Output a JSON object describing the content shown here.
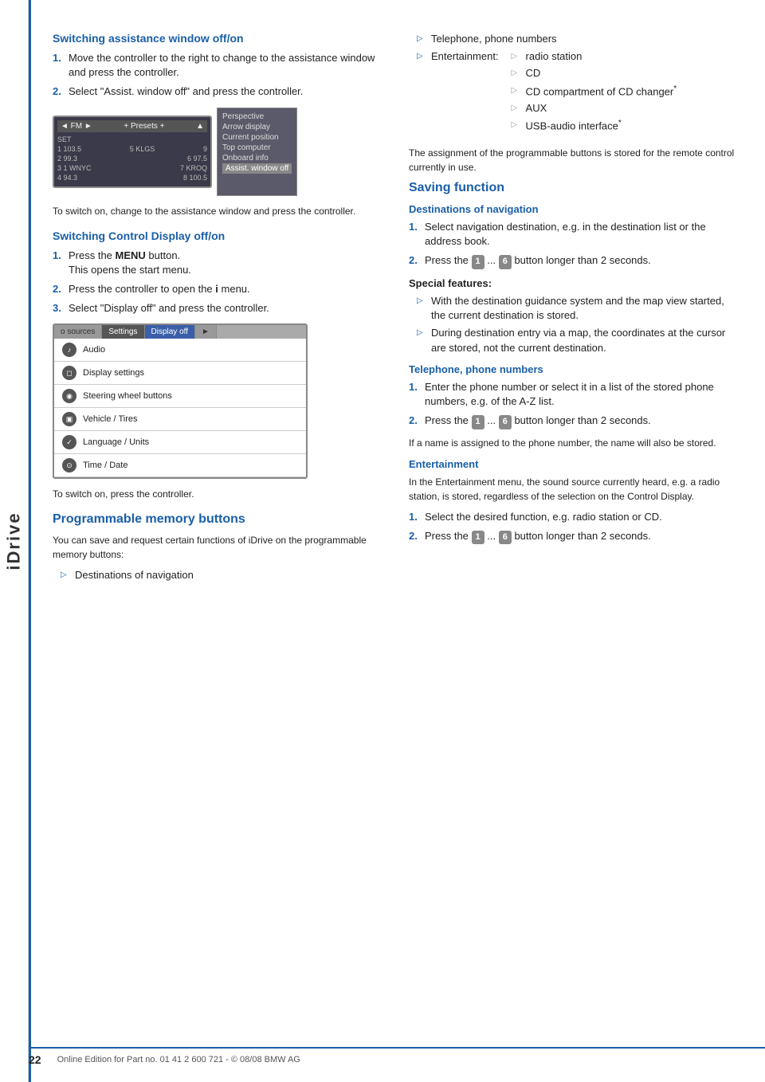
{
  "sidebar": {
    "label": "iDrive"
  },
  "page": {
    "number": "22",
    "footer_text": "Online Edition for Part no. 01 41 2 600 721 - © 08/08 BMW AG"
  },
  "left_col": {
    "section1": {
      "heading": "Switching assistance window off/on",
      "steps": [
        {
          "num": "1.",
          "text": "Move the controller to the right to change to the assistance window and press the controller."
        },
        {
          "num": "2.",
          "text": "Select \"Assist. window off\" and press the controller."
        }
      ],
      "note": "To switch on, change to the assistance window and press the controller.",
      "screen": {
        "header_left": "◄ FM ►",
        "header_right": "▲",
        "presets": "+ Presets +",
        "set_label": "SET",
        "rows": [
          {
            "freq1": "1 103.5",
            "freq2": "5 KLGS",
            "freq3": "9"
          },
          {
            "freq1": "2 99.3",
            "freq2": "6 97.5"
          },
          {
            "freq1": "3 1 WNYC",
            "freq2": "7 KROQ"
          },
          {
            "freq1": "4 94.3",
            "freq2": "8 100.5"
          }
        ],
        "menu_items": [
          {
            "label": "Perspective",
            "active": false
          },
          {
            "label": "Arrow display",
            "active": false
          },
          {
            "label": "Current position",
            "active": false
          },
          {
            "label": "Top computer",
            "active": false
          },
          {
            "label": "Onboard info",
            "active": false
          },
          {
            "label": "Assist. window off",
            "active": true
          }
        ]
      }
    },
    "section2": {
      "heading": "Switching Control Display off/on",
      "steps": [
        {
          "num": "1.",
          "text_before": "Press the ",
          "bold": "MENU",
          "text_after": " button.\nThis opens the start menu."
        },
        {
          "num": "2.",
          "text": "Press the controller to open the i menu."
        },
        {
          "num": "3.",
          "text": "Select \"Display off\" and press the controller."
        }
      ],
      "note": "To switch on, press the controller.",
      "settings_screen": {
        "tabs": [
          {
            "label": "o sources",
            "active": false
          },
          {
            "label": "Settings",
            "active": true
          },
          {
            "label": "Display off",
            "active": false,
            "blue": true
          },
          {
            "label": "►",
            "active": false
          }
        ],
        "items": [
          {
            "icon": "♪",
            "label": "Audio"
          },
          {
            "icon": "◻",
            "label": "Display settings"
          },
          {
            "icon": "◎",
            "label": "Steering wheel buttons"
          },
          {
            "icon": "🚗",
            "label": "Vehicle / Tires"
          },
          {
            "icon": "🌐",
            "label": "Language / Units"
          },
          {
            "icon": "⏱",
            "label": "Time / Date"
          }
        ]
      }
    },
    "section3": {
      "heading": "Programmable memory buttons",
      "intro": "You can save and request certain functions of iDrive on the programmable memory buttons:",
      "bullets": [
        "Destinations of navigation"
      ]
    }
  },
  "right_col": {
    "bullets_continued": [
      "Telephone, phone numbers",
      "Entertainment:"
    ],
    "entertainment_sub": [
      "radio station",
      "CD",
      "CD compartment of CD changer*",
      "AUX",
      "USB-audio interface*"
    ],
    "note_assignment": "The assignment of the programmable buttons is stored for the remote control currently in use.",
    "saving_function": {
      "heading": "Saving function",
      "destinations_heading": "Destinations of navigation",
      "destinations_steps": [
        {
          "num": "1.",
          "text": "Select navigation destination, e.g. in the destination list or the address book."
        },
        {
          "num": "2.",
          "text_before": "Press the ",
          "btn1": "1",
          "text_mid": " ... ",
          "btn2": "6",
          "text_after": " button longer than 2 seconds."
        }
      ],
      "special_label": "Special features:",
      "special_bullets": [
        "With the destination guidance system and the map view started, the current destination is stored.",
        "During destination entry via a map, the coordinates at the cursor are stored, not the current destination."
      ],
      "telephone_heading": "Telephone, phone numbers",
      "telephone_steps": [
        {
          "num": "1.",
          "text": "Enter the phone number or select it in a list of the stored phone numbers, e.g. of the A-Z list."
        },
        {
          "num": "2.",
          "text_before": "Press the ",
          "btn1": "1",
          "text_mid": " ... ",
          "btn2": "6",
          "text_after": " button longer than 2 seconds."
        }
      ],
      "telephone_note": "If a name is assigned to the phone number, the name will also be stored.",
      "entertainment_heading": "Entertainment",
      "entertainment_body": "In the Entertainment menu, the sound source currently heard, e.g. a radio station, is stored, regardless of the selection on the Control Display.",
      "entertainment_steps": [
        {
          "num": "1.",
          "text": "Select the desired function, e.g. radio station or CD."
        },
        {
          "num": "2.",
          "text_before": "Press the ",
          "btn1": "1",
          "text_mid": " ... ",
          "btn2": "6",
          "text_after": " button longer than 2 seconds."
        }
      ]
    }
  }
}
